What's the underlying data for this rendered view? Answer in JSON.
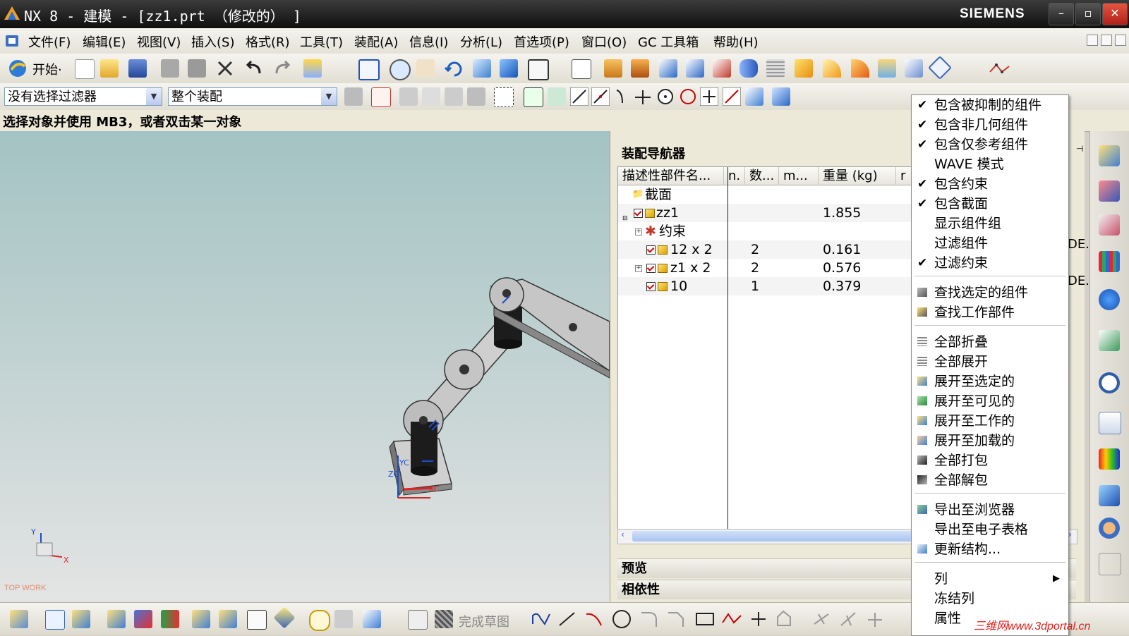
{
  "window": {
    "title": "NX 8 - 建模 - [zz1.prt （修改的） ]",
    "brand": "SIEMENS",
    "minimize": "–",
    "restore": "▫",
    "close": "✕"
  },
  "menubar": {
    "items": [
      "文件(F)",
      "编辑(E)",
      "视图(V)",
      "插入(S)",
      "格式(R)",
      "工具(T)",
      "装配(A)",
      "信息(I)",
      "分析(L)",
      "首选项(P)",
      "窗口(O)",
      "GC 工具箱",
      "帮助(H)"
    ]
  },
  "toolbar": {
    "start_label": "开始·"
  },
  "filters": {
    "selection_filter": "没有选择过滤器",
    "scope": "整个装配"
  },
  "cue": "选择对象并使用 MB3，或者双击某一对象",
  "viewport": {
    "corner_label": "TOP WORK",
    "axis_x": "X",
    "axis_y": "Y",
    "axis_xc": "XC",
    "axis_yc": "YC",
    "axis_zc": "ZC"
  },
  "navigator": {
    "title": "装配导航器",
    "columns": [
      "描述性部件名...",
      "n.",
      "数...",
      "m...",
      "重量 (kg)",
      "r"
    ],
    "rows": [
      {
        "name": "截面",
        "qty": "",
        "weight": ""
      },
      {
        "name": "zz1",
        "qty": "",
        "weight": "1.855"
      },
      {
        "name": "约束",
        "qty": "",
        "weight": ""
      },
      {
        "name": "12 x 2",
        "qty": "2",
        "weight": "0.161"
      },
      {
        "name": "z1 x 2",
        "qty": "2",
        "weight": "0.576"
      },
      {
        "name": "10",
        "qty": "1",
        "weight": "0.379"
      }
    ],
    "clipped_right": [
      "DE..",
      "DE.."
    ],
    "preview_label": "预览",
    "dependency_label": "相依性",
    "pin_icon": "⊣"
  },
  "context_menu": {
    "groups": [
      [
        {
          "label": "包含被抑制的组件",
          "checked": true
        },
        {
          "label": "包含非几何组件",
          "checked": true
        },
        {
          "label": "包含仅参考组件",
          "checked": true
        },
        {
          "label": "WAVE 模式",
          "checked": false
        },
        {
          "label": "包含约束",
          "checked": true
        },
        {
          "label": "包含截面",
          "checked": true
        },
        {
          "label": "显示组件组",
          "checked": false
        },
        {
          "label": "过滤组件",
          "checked": false
        },
        {
          "label": "过滤约束",
          "checked": true
        }
      ],
      [
        {
          "label": "查找选定的组件",
          "icon": "find-selected-icon"
        },
        {
          "label": "查找工作部件",
          "icon": "find-work-part-icon"
        }
      ],
      [
        {
          "label": "全部折叠",
          "icon": "collapse-all-icon"
        },
        {
          "label": "全部展开",
          "icon": "expand-all-icon"
        },
        {
          "label": "展开至选定的",
          "icon": "expand-selected-icon"
        },
        {
          "label": "展开至可见的",
          "icon": "expand-visible-icon"
        },
        {
          "label": "展开至工作的",
          "icon": "expand-work-icon"
        },
        {
          "label": "展开至加载的",
          "icon": "expand-loaded-icon"
        },
        {
          "label": "全部打包",
          "icon": "pack-all-icon"
        },
        {
          "label": "全部解包",
          "icon": "unpack-all-icon"
        }
      ],
      [
        {
          "label": "导出至浏览器",
          "icon": "export-browser-icon"
        },
        {
          "label": "导出至电子表格",
          "icon": ""
        },
        {
          "label": "更新结构...",
          "icon": "update-structure-icon"
        }
      ],
      [
        {
          "label": "列",
          "submenu": true
        },
        {
          "label": "冻结列"
        },
        {
          "label": "属性"
        }
      ]
    ]
  },
  "bottom_toolbar": {
    "finish_sketch": "完成草图"
  },
  "watermark": "三维网www.3dportal.cn"
}
